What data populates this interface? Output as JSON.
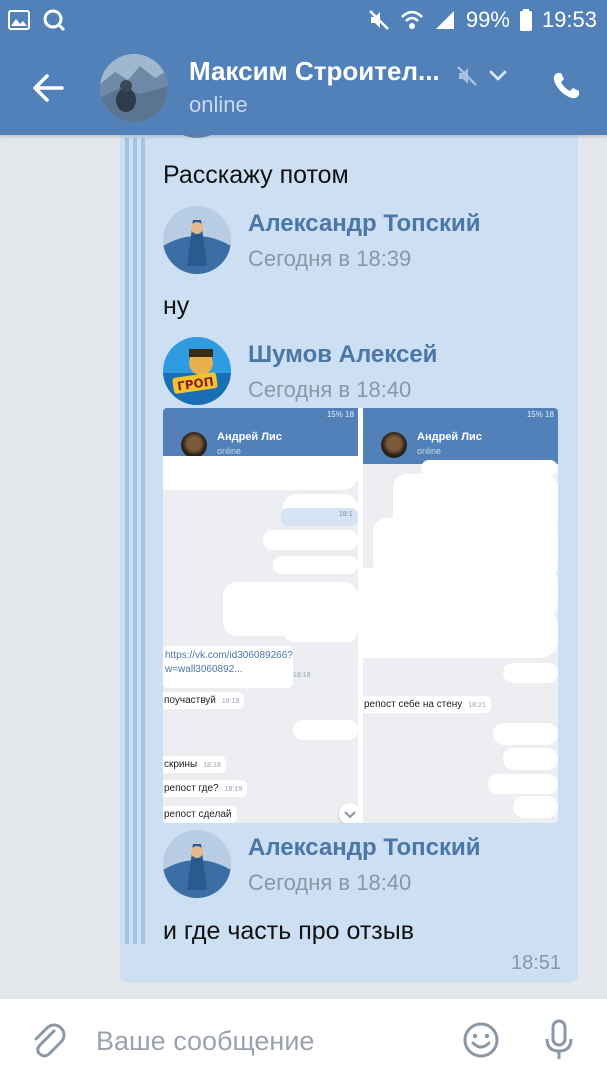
{
  "status_bar": {
    "battery": "99%",
    "time": "19:53",
    "icons": [
      "gallery-icon",
      "search-icon",
      "mute-icon",
      "wifi-icon",
      "signal-icon",
      "battery-icon"
    ]
  },
  "header": {
    "title": "Максим Строител...",
    "status": "online",
    "icons": [
      "back-arrow-icon",
      "muted-bell-icon",
      "chevron-down-icon",
      "phone-icon"
    ]
  },
  "message": {
    "time": "18:51",
    "forwarded": [
      {
        "text": "Расскажу потом"
      },
      {
        "author": "Александр Топский",
        "date": "Сегодня в 18:39",
        "text": "ну"
      },
      {
        "author": "Шумов Алексей",
        "date": "Сегодня в 18:40",
        "avatar_text": "ГРОП",
        "attachment": {
          "screenshots": [
            {
              "status": "15% 18",
              "contact_name": "Андрей Лис",
              "contact_status": "online",
              "link": "https://vk.com/id306089266?w=wall3060892...",
              "link_time": "18:18",
              "out_time": "18:1",
              "messages": [
                {
                  "text": "поучаствуй",
                  "time": "18:18"
                },
                {
                  "text": "скрины",
                  "time": "18:18"
                },
                {
                  "text": "репост где?",
                  "time": "18:19"
                },
                {
                  "text": "репост сделай",
                  "time": ""
                }
              ]
            },
            {
              "status": "15% 18",
              "contact_name": "Андрей Лис",
              "contact_status": "online",
              "messages": [
                {
                  "text": "репост себе на стену",
                  "time": "18:21"
                }
              ]
            }
          ]
        }
      },
      {
        "author": "Александр Топский",
        "date": "Сегодня в 18:40",
        "text": "и где часть про отзыв"
      }
    ]
  },
  "composer": {
    "placeholder": "Ваше сообщение",
    "icons": [
      "attach-icon",
      "emoji-icon",
      "mic-icon"
    ]
  },
  "colors": {
    "header_bg": "#5181b8",
    "bubble_bg": "#cddff2",
    "author_name": "#4a76a8",
    "chat_bg": "#e4e8ed"
  }
}
